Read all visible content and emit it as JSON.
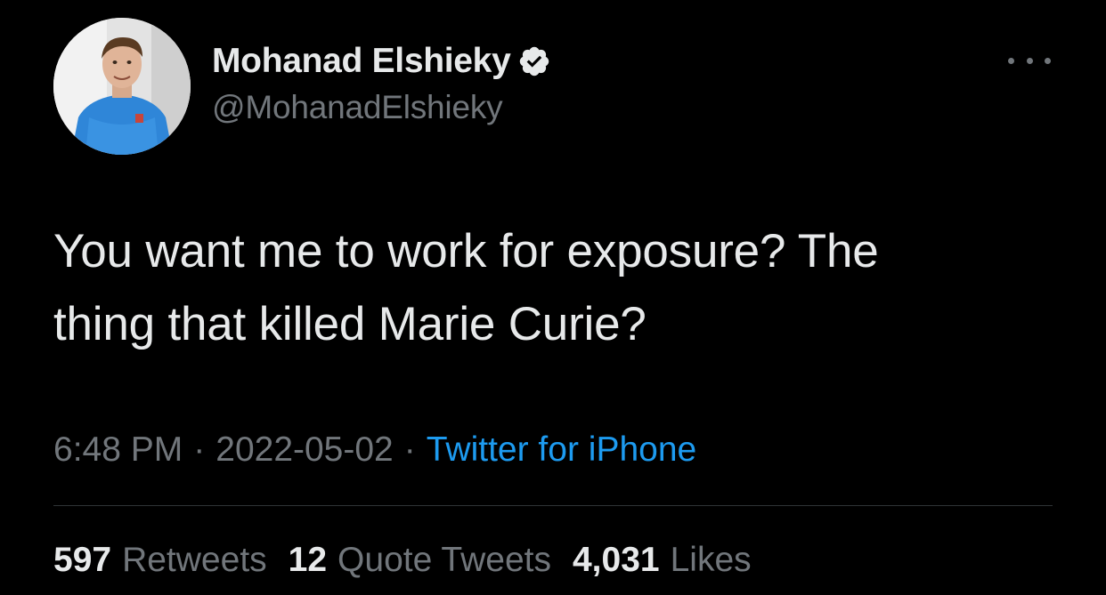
{
  "author": {
    "display_name": "Mohanad Elshieky",
    "handle": "@MohanadElshieky",
    "verified": true,
    "verified_icon": "verified-badge-icon"
  },
  "tweet": {
    "lines": [
      "You want me to work for exposure? The",
      "thing that killed Marie Curie?"
    ]
  },
  "meta": {
    "time": "6:48 PM",
    "separator": "·",
    "date": "2022-05-02",
    "source": "Twitter for iPhone"
  },
  "stats": {
    "retweets": {
      "count": "597",
      "label": "Retweets"
    },
    "quotes": {
      "count": "12",
      "label": "Quote Tweets"
    },
    "likes": {
      "count": "4,031",
      "label": "Likes"
    }
  },
  "colors": {
    "background": "#000000",
    "text": "#e7e9ea",
    "secondary": "#71767b",
    "link": "#1d9bf0",
    "divider": "#2f3336"
  }
}
